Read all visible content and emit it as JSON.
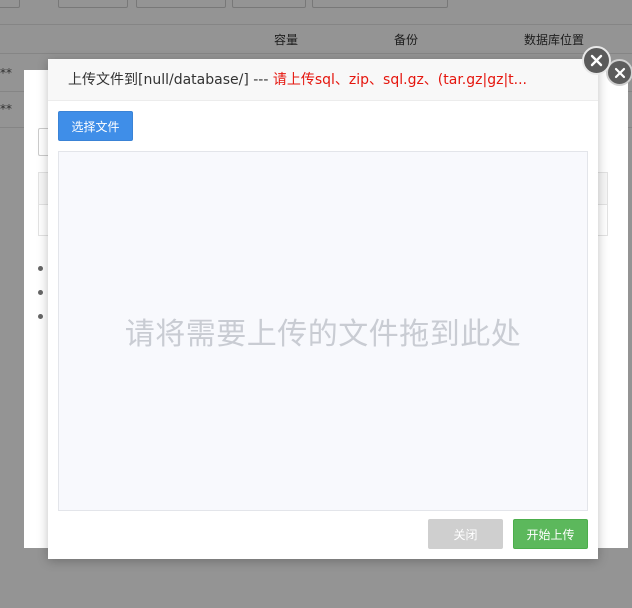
{
  "background": {
    "table_headers": [
      "容量",
      "备份",
      "数据库位置"
    ],
    "row_marks": [
      "**",
      "**"
    ]
  },
  "dialog": {
    "title_path": "上传文件到[null/database/] --- ",
    "title_hint": "请上传sql、zip、sql.gz、(tar.gz|gz|t...",
    "select_files_label": "选择文件",
    "drop_hint": "请将需要上传的文件拖到此处",
    "close_label": "关闭",
    "start_upload_label": "开始上传"
  },
  "icons": {
    "dialog_close": "close-icon",
    "under_close": "close-icon"
  },
  "colors": {
    "primary": "#3f8ee8",
    "success": "#5cb85c",
    "disabled": "#cfcfcf",
    "hint_red": "#e5160e"
  }
}
